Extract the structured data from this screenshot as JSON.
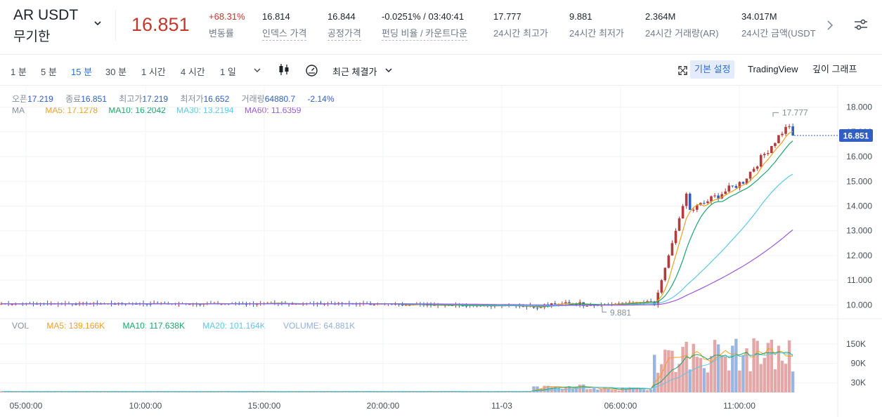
{
  "header": {
    "pair": "AR USDT",
    "contract": "무기한",
    "last_price": "16.851",
    "stats": [
      {
        "value": "+68.31%",
        "label": "변동률",
        "red": true,
        "underline": false
      },
      {
        "value": "16.814",
        "label": "인덱스 가격",
        "underline": true
      },
      {
        "value": "16.844",
        "label": "공정가격",
        "underline": true
      },
      {
        "value": "-0.0251% / 03:40:41",
        "label": "펀딩 비율 / 카운트다운",
        "underline": true
      },
      {
        "value": "17.777",
        "label": "24시간 최고가",
        "underline": false
      },
      {
        "value": "9.881",
        "label": "24시간 최저가",
        "underline": false
      },
      {
        "value": "2.364M",
        "label": "24시간 거래량(AR)",
        "underline": false
      },
      {
        "value": "34.017M",
        "label": "24시간 금액(USDT",
        "underline": false
      }
    ]
  },
  "toolbar": {
    "intervals": [
      "1 분",
      "5 분",
      "15 분",
      "30 분",
      "1 시간",
      "4 시간",
      "1 일"
    ],
    "active_interval": "15 분",
    "price_type": "최근 체결가",
    "tabs": [
      "기본 설정",
      "TradingView",
      "깊이 그래프"
    ],
    "active_tab": "기본 설정"
  },
  "ohlc_legend": {
    "open_label": "오픈",
    "open": "17.219",
    "close_label": "종료",
    "close": "16.851",
    "high_label": "최고가",
    "high": "17.219",
    "low_label": "최저가",
    "low": "16.652",
    "volume_label": "거래량",
    "volume": "64880.7",
    "change": "-2.14%"
  },
  "ma_legend": {
    "label": "MA",
    "items": [
      {
        "text": "MA5: 17.1278",
        "color": "#f0a020"
      },
      {
        "text": "MA10: 16.2042",
        "color": "#1aa56b"
      },
      {
        "text": "MA30: 13.2194",
        "color": "#5bc8e8"
      },
      {
        "text": "MA60: 11.6359",
        "color": "#9b59d9"
      }
    ]
  },
  "vol_legend": {
    "label": "VOL",
    "items": [
      {
        "text": "MA5: 139.166K",
        "color": "#f0a020"
      },
      {
        "text": "MA10: 117.638K",
        "color": "#1aa56b"
      },
      {
        "text": "MA20: 101.164K",
        "color": "#5bc8e8"
      },
      {
        "text": "VOLUME: 64.881K",
        "color": "#8fb0dc"
      }
    ]
  },
  "chart_data": {
    "type": "candlestick",
    "y_ticks": [
      "18.000",
      "17.000",
      "16.000",
      "15.000",
      "14.000",
      "13.000",
      "12.000",
      "11.000",
      "10.000"
    ],
    "y_range": [
      9.5,
      18.3
    ],
    "vol_ticks": [
      "150K",
      "90K",
      "30K"
    ],
    "vol_max": 200000,
    "x_ticks": [
      "05:00:00",
      "10:00:00",
      "15:00:00",
      "20:00:00",
      "11-03",
      "06:00:00",
      "11:00:00"
    ],
    "current_price_label": "16.851",
    "high_marker": "17.777",
    "low_marker": "9.881",
    "colors": {
      "up": "#2f5fc0",
      "down": "#b23b3b",
      "grid": "#f2f3f5"
    }
  }
}
